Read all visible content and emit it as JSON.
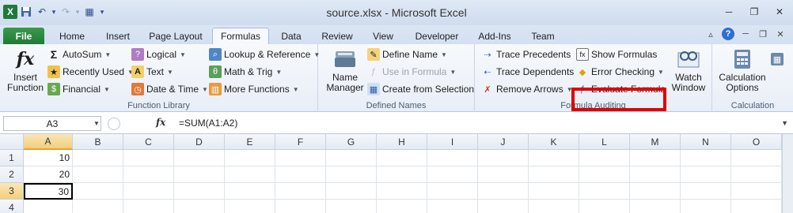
{
  "window": {
    "title": "source.xlsx - Microsoft Excel",
    "app_icon": "X",
    "minimize": "─",
    "restore": "❐",
    "close": "✕"
  },
  "qat": {
    "save": "💾",
    "undo": "↶",
    "undo_dd": "▾",
    "redo": "↷",
    "redo_dd": "▾",
    "custom": "▦",
    "customize": "▾"
  },
  "tabs": [
    "File",
    "Home",
    "Insert",
    "Page Layout",
    "Formulas",
    "Data",
    "Review",
    "View",
    "Developer",
    "Add-Ins",
    "Team"
  ],
  "ribbon_right": {
    "minimize": "▵",
    "help": "?",
    "wmin": "─",
    "wrestore": "❐",
    "wclose": "✕"
  },
  "function_library": {
    "label": "Function Library",
    "insert_function": "Insert Function",
    "insert_function_lines": [
      "Insert",
      "Function"
    ],
    "fx_glyph": "fx",
    "autosum": "AutoSum",
    "recently_used": "Recently Used",
    "financial": "Financial",
    "logical": "Logical",
    "text": "Text",
    "date_time": "Date & Time",
    "lookup_reference": "Lookup & Reference",
    "math_trig": "Math & Trig",
    "more_functions": "More Functions"
  },
  "defined_names": {
    "label": "Defined Names",
    "name_manager_lines": [
      "Name",
      "Manager"
    ],
    "define_name": "Define Name",
    "use_in_formula": "Use in Formula",
    "create_from_selection": "Create from Selection"
  },
  "formula_auditing": {
    "label": "Formula Auditing",
    "trace_precedents": "Trace Precedents",
    "trace_dependents": "Trace Dependents",
    "remove_arrows": "Remove Arrows",
    "show_formulas": "Show Formulas",
    "error_checking": "Error Checking",
    "evaluate_formula": "Evaluate Formula",
    "watch_window_lines": [
      "Watch",
      "Window"
    ]
  },
  "calculation": {
    "label": "Calculation",
    "calc_options_lines": [
      "Calculation",
      "Options"
    ]
  },
  "formula_bar": {
    "name_box": "A3",
    "fx": "fx",
    "formula": "=SUM(A1:A2)"
  },
  "sheet": {
    "columns": [
      "A",
      "B",
      "C",
      "D",
      "E",
      "F",
      "G",
      "H",
      "I",
      "J",
      "K",
      "L",
      "M",
      "N",
      "O"
    ],
    "rows": [
      "1",
      "2",
      "3",
      "4"
    ],
    "cells": {
      "A1": "10",
      "A2": "20",
      "A3": "30"
    }
  }
}
